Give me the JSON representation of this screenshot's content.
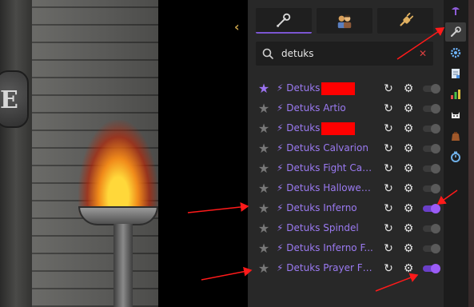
{
  "search": {
    "value": "detuks",
    "clear_glyph": "✕"
  },
  "tabs": [
    {
      "icon": "wrench-icon",
      "active": true
    },
    {
      "icon": "profile-icon",
      "active": false
    },
    {
      "icon": "plug-icon",
      "active": false
    }
  ],
  "plugins": [
    {
      "prefix": "⚡",
      "name": "Detuks",
      "redacted": true,
      "favorite": true,
      "enabled": false
    },
    {
      "prefix": "⚡",
      "name": "Detuks Artio",
      "redacted": false,
      "favorite": false,
      "enabled": false
    },
    {
      "prefix": "⚡",
      "name": "Detuks",
      "redacted": true,
      "favorite": false,
      "enabled": false
    },
    {
      "prefix": "⚡",
      "name": "Detuks Calvarion",
      "redacted": false,
      "favorite": false,
      "enabled": false
    },
    {
      "prefix": "⚡",
      "name": "Detuks Fight Cav...",
      "redacted": false,
      "favorite": false,
      "enabled": false
    },
    {
      "prefix": "⚡",
      "name": "Detuks Hallowed ...",
      "redacted": false,
      "favorite": false,
      "enabled": false
    },
    {
      "prefix": "⚡",
      "name": "Detuks Inferno",
      "redacted": false,
      "favorite": false,
      "enabled": true
    },
    {
      "prefix": "⚡",
      "name": "Detuks Spindel",
      "redacted": false,
      "favorite": false,
      "enabled": false
    },
    {
      "prefix": "⚡",
      "name": "Detuks Inferno F...",
      "redacted": false,
      "favorite": false,
      "enabled": false
    },
    {
      "prefix": "⚡",
      "name": "Detuks Prayer Fl...",
      "redacted": false,
      "favorite": false,
      "enabled": true
    }
  ],
  "sidebar_icons": [
    "notes-icon",
    "wrench-icon",
    "gear-icon",
    "notepad-icon",
    "chart-icon",
    "cat-icon",
    "bag-icon",
    "timer-icon"
  ],
  "game": {
    "sign_letter": "E"
  },
  "colors": {
    "accent": "#9b5cf7",
    "plugin_text": "#9b7af2",
    "panel_bg": "#282828",
    "annotation_red": "#ff1a1a"
  }
}
